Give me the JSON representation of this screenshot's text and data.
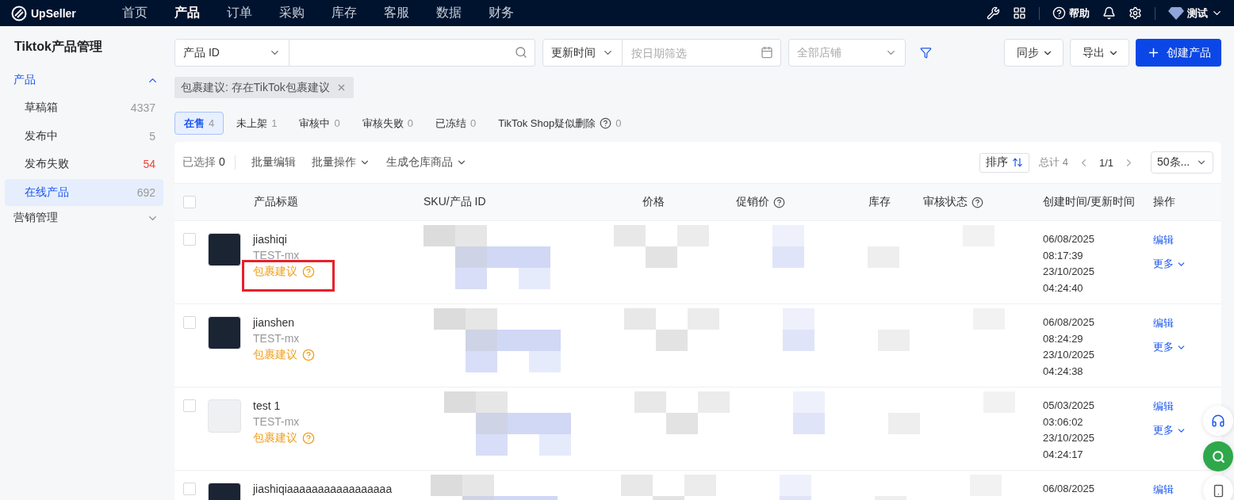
{
  "topnav": {
    "logo": "UpSeller",
    "items": [
      {
        "label": "首页",
        "selected": false
      },
      {
        "label": "产品",
        "selected": true
      },
      {
        "label": "订单",
        "selected": false
      },
      {
        "label": "采购",
        "selected": false
      },
      {
        "label": "库存",
        "selected": false
      },
      {
        "label": "客服",
        "selected": false
      },
      {
        "label": "数据",
        "selected": false
      },
      {
        "label": "财务",
        "selected": false
      }
    ],
    "help": "帮助",
    "user": "测试"
  },
  "sidebar": {
    "title": "Tiktok产品管理",
    "groups": [
      {
        "label": "产品",
        "expanded": true,
        "items": [
          {
            "label": "草稿箱",
            "count": "4337",
            "color": "#999999",
            "selected": false
          },
          {
            "label": "发布中",
            "count": "5",
            "color": "#999999",
            "selected": false
          },
          {
            "label": "发布失败",
            "count": "54",
            "color": "#f04438",
            "selected": false
          },
          {
            "label": "在线产品",
            "count": "692",
            "color": "#999999",
            "selected": true
          }
        ]
      },
      {
        "label": "营销管理",
        "expanded": false
      }
    ]
  },
  "filters": {
    "search_type": "产品 ID",
    "time_type": "更新时间",
    "date_placeholder": "按日期筛选",
    "store_placeholder": "全部店铺",
    "buttons": [
      "同步",
      "导出"
    ],
    "create": "创建产品"
  },
  "active_filter": "包裹建议: 存在TikTok包裹建议",
  "tabs": [
    {
      "label": "在售",
      "count": "4",
      "selected": true,
      "help": false
    },
    {
      "label": "未上架",
      "count": "1",
      "selected": false,
      "help": false
    },
    {
      "label": "审核中",
      "count": "0",
      "selected": false,
      "help": false
    },
    {
      "label": "审核失败",
      "count": "0",
      "selected": false,
      "help": false
    },
    {
      "label": "已冻结",
      "count": "0",
      "selected": false,
      "help": false
    },
    {
      "label": "TikTok Shop疑似删除",
      "count": "0",
      "selected": false,
      "help": true
    }
  ],
  "toolbar": {
    "selected_label": "已选择",
    "selected_count": "0",
    "actions": [
      {
        "label": "批量编辑",
        "dropdown": false
      },
      {
        "label": "批量操作",
        "dropdown": true
      },
      {
        "label": "生成仓库商品",
        "dropdown": true
      }
    ],
    "sort": "排序",
    "total": "总计 4",
    "page": "1/1",
    "page_size": "50条..."
  },
  "table": {
    "all_checked": false,
    "columns": [
      {
        "label": "产品标题",
        "help": false
      },
      {
        "label": "SKU/产品 ID",
        "help": false
      },
      {
        "label": "价格",
        "help": false
      },
      {
        "label": "促销价",
        "help": true
      },
      {
        "label": "库存",
        "help": false
      },
      {
        "label": "审核状态",
        "help": true
      },
      {
        "label": "创建时间/更新时间",
        "help": false
      },
      {
        "label": "操作",
        "help": false
      }
    ],
    "rows": [
      {
        "title": "jiashiqi",
        "store": "TEST-mx",
        "tag": "包裹建议",
        "highlighted": true,
        "checked": false,
        "kind": "product",
        "times": [
          "06/08/2025",
          "08:17:39",
          "23/10/2025",
          "04:24:40"
        ],
        "actions": [
          "编辑",
          "更多"
        ]
      },
      {
        "title": "jianshen",
        "store": "TEST-mx",
        "tag": "包裹建议",
        "highlighted": false,
        "checked": false,
        "kind": "product",
        "times": [
          "06/08/2025",
          "08:24:29",
          "23/10/2025",
          "04:24:38"
        ],
        "actions": [
          "编辑",
          "更多"
        ]
      },
      {
        "title": "test 1",
        "store": "TEST-mx",
        "tag": "包裹建议",
        "highlighted": false,
        "checked": false,
        "kind": "person",
        "times": [
          "05/03/2025",
          "03:06:02",
          "23/10/2025",
          "04:24:17"
        ],
        "actions": [
          "编辑",
          "更多"
        ]
      },
      {
        "title": "jiashiqiaaaaaaaaaaaaaaaaa",
        "checked": false,
        "kind": "product",
        "times": [
          "06/08/2025"
        ],
        "actions": [
          "编辑"
        ]
      }
    ]
  }
}
